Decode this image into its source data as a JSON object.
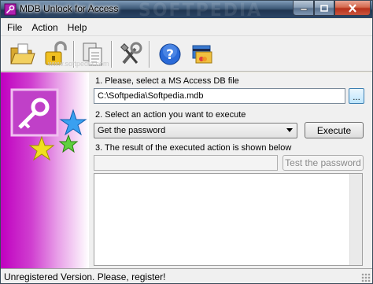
{
  "window": {
    "title": "MDB Unlock for Access",
    "watermark": "SOFTPEDIA"
  },
  "menu": [
    "File",
    "Action",
    "Help"
  ],
  "toolbar": {
    "buttons": [
      "open-folder-icon",
      "unlock-icon",
      "copy-document-icon",
      "tools-icon",
      "help-icon",
      "register-card-icon"
    ],
    "watermark": "www.softpedia.com"
  },
  "main": {
    "step1_label": "1. Please, select a MS Access DB file",
    "file_path": "C:\\Softpedia\\Softpedia.mdb",
    "browse_label": "...",
    "step2_label": "2. Select an action you want to execute",
    "action_selected": "Get the password",
    "execute_label": "Execute",
    "step3_label": "3. The result of the executed action is shown below",
    "result_value": "",
    "test_password_label": "Test the password"
  },
  "status": {
    "text": "Unregistered Version. Please, register!"
  }
}
